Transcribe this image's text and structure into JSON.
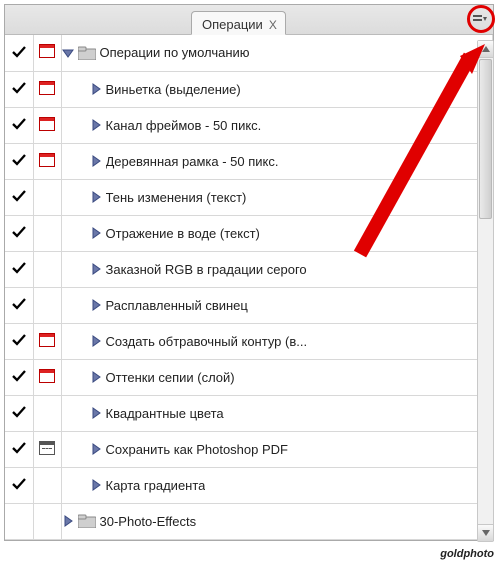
{
  "tab": {
    "title": "Операции",
    "close_glyph": "X"
  },
  "rows": [
    {
      "check": true,
      "dialog": "red",
      "expand": "open",
      "indent": 0,
      "folder": true,
      "label": "Операции по умолчанию"
    },
    {
      "check": true,
      "dialog": "red",
      "expand": "closed",
      "indent": 1,
      "folder": false,
      "label": "Виньетка (выделение)"
    },
    {
      "check": true,
      "dialog": "red",
      "expand": "closed",
      "indent": 1,
      "folder": false,
      "label": "Канал фреймов - 50 пикс."
    },
    {
      "check": true,
      "dialog": "red",
      "expand": "closed",
      "indent": 1,
      "folder": false,
      "label": "Деревянная рамка - 50 пикс."
    },
    {
      "check": true,
      "dialog": "none",
      "expand": "closed",
      "indent": 1,
      "folder": false,
      "label": "Тень изменения (текст)"
    },
    {
      "check": true,
      "dialog": "none",
      "expand": "closed",
      "indent": 1,
      "folder": false,
      "label": "Отражение в воде (текст)"
    },
    {
      "check": true,
      "dialog": "none",
      "expand": "closed",
      "indent": 1,
      "folder": false,
      "label": "Заказной RGB в градации серого"
    },
    {
      "check": true,
      "dialog": "none",
      "expand": "closed",
      "indent": 1,
      "folder": false,
      "label": "Расплавленный свинец"
    },
    {
      "check": true,
      "dialog": "red",
      "expand": "closed",
      "indent": 1,
      "folder": false,
      "label": "Создать обтравочный контур (в..."
    },
    {
      "check": true,
      "dialog": "red",
      "expand": "closed",
      "indent": 1,
      "folder": false,
      "label": "Оттенки сепии (слой)"
    },
    {
      "check": true,
      "dialog": "none",
      "expand": "closed",
      "indent": 1,
      "folder": false,
      "label": "Квадрантные цвета"
    },
    {
      "check": true,
      "dialog": "mixed",
      "expand": "closed",
      "indent": 1,
      "folder": false,
      "label": "Сохранить как Photoshop PDF"
    },
    {
      "check": true,
      "dialog": "none",
      "expand": "closed",
      "indent": 1,
      "folder": false,
      "label": "Карта градиента"
    },
    {
      "check": false,
      "dialog": "none",
      "expand": "closed",
      "indent": 0,
      "folder": true,
      "label": "30-Photo-Effects"
    }
  ],
  "watermark": "goldphoto"
}
